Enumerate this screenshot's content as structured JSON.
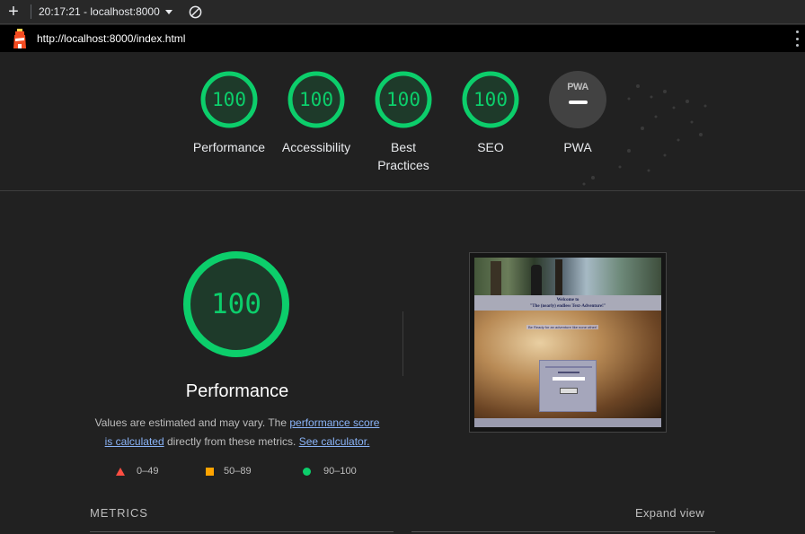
{
  "toolbar": {
    "new_label": "+",
    "session": "20:17:21 - localhost:8000"
  },
  "urlbar": {
    "url": "http://localhost:8000/index.html"
  },
  "categories": [
    {
      "label": "Performance",
      "score": "100"
    },
    {
      "label": "Accessibility",
      "score": "100"
    },
    {
      "label": "Best Practices",
      "score": "100"
    },
    {
      "label": "SEO",
      "score": "100"
    },
    {
      "label": "PWA",
      "badge": "PWA"
    }
  ],
  "main": {
    "score": "100",
    "title": "Performance",
    "desc_1": "Values are estimated and may vary. The ",
    "link_score": "performance score is calculated",
    "desc_2": " directly from these metrics. ",
    "link_calc": "See calculator.",
    "legend": {
      "fail": "0–49",
      "average": "50–89",
      "pass": "90–100"
    }
  },
  "screenshot": {
    "title_1": "Welcome to",
    "title_2": "\"The (nearly) endless Text-Adventure!\"",
    "tagline": "Be Ready for an adventure like none other!"
  },
  "metrics": {
    "heading": "METRICS",
    "expand": "Expand view"
  },
  "colors": {
    "pass": "#0cce6b",
    "average": "#ffa400",
    "fail": "#ff4e42",
    "link": "#8ab4f8"
  }
}
